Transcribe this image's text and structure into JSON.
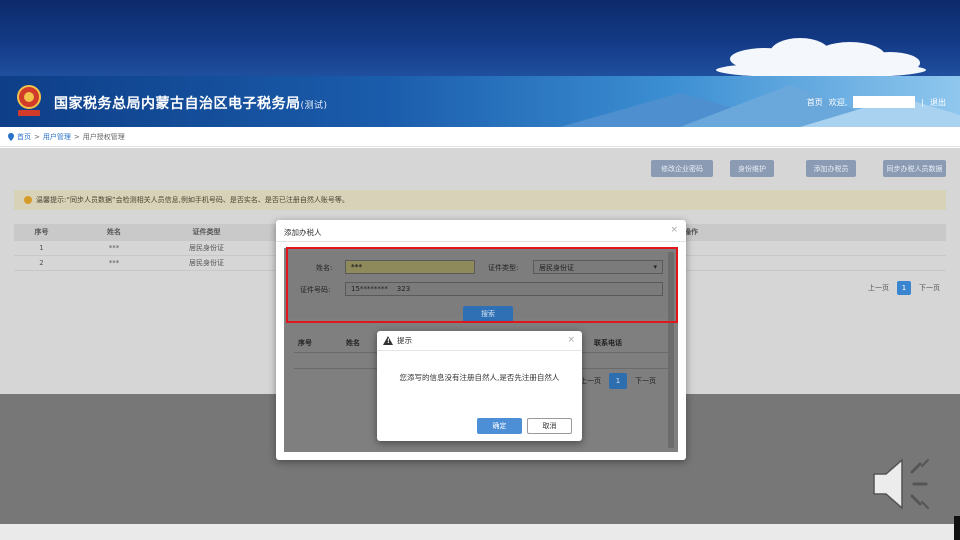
{
  "header": {
    "title": "国家税务总局内蒙古自治区电子税务局",
    "title_suffix": "(测试)",
    "home": "首页",
    "welcome": "欢迎,",
    "separator": "|",
    "logout": "退出"
  },
  "breadcrumb": {
    "home": "首页",
    "sep1": ">",
    "section": "用户管理",
    "sep2": ">",
    "current": "用户授权管理"
  },
  "toolbar": {
    "buttons": [
      "修改企业密码",
      "身份维护",
      "添加办税员",
      "同步办税人员数据"
    ]
  },
  "notice": {
    "text": "温馨提示:“同步人员数据”会检测相关人员信息,例如手机号码、是否实名、是否已注册自然人账号等。"
  },
  "background_table": {
    "columns": [
      "序号",
      "姓名",
      "证件类型",
      "操作"
    ],
    "rows": [
      {
        "index": "1",
        "name": "***",
        "id_type": "居民身份证"
      },
      {
        "index": "2",
        "name": "***",
        "id_type": "居民身份证"
      }
    ],
    "pager": {
      "prev": "上一页",
      "page": "1",
      "next": "下一页"
    }
  },
  "modal": {
    "title": "添加办税人",
    "close": "×",
    "name_label": "姓名:",
    "name_value": "***",
    "id_type_label": "证件类型:",
    "id_type_value": "居民身份证",
    "id_number_label": "证件号码:",
    "id_number_value": "15********    323",
    "search_button": "搜索",
    "result_columns": [
      "序号",
      "姓名",
      "联系电话"
    ],
    "pager": {
      "prev": "上一页",
      "page": "1",
      "next": "下一页"
    }
  },
  "dialog": {
    "title": "提示",
    "close": "×",
    "message": "您添写的信息没有注册自然人,是否先注册自然人",
    "ok": "确定",
    "cancel": "取消"
  },
  "icons": {
    "emblem": "national-tax-emblem-icon",
    "location": "location-pin-icon",
    "warning": "warning-triangle-icon",
    "speaker": "speaker-icon"
  },
  "colors": {
    "header_blue": "#1a5cab",
    "highlight_red": "#e0161b",
    "primary_button": "#4d8fd6"
  }
}
